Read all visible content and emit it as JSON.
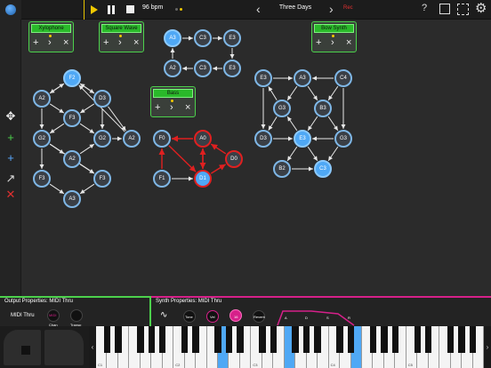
{
  "topbar": {
    "bpm": "96 bpm",
    "song_title": "Three Days",
    "record_label": "Rec",
    "help_label": "?",
    "prev_symbol": "‹",
    "next_symbol": "›",
    "gear_symbol": "⚙"
  },
  "instruments": [
    {
      "id": "xylophone",
      "name": "Xylophone"
    },
    {
      "id": "square_wave",
      "name": "Square Wave"
    },
    {
      "id": "bass",
      "name": "Bass"
    },
    {
      "id": "bow_synth",
      "name": "Bow Synth"
    }
  ],
  "instrument_controls": [
    "+",
    "›",
    "×"
  ],
  "nodes": [
    {
      "label": "F2",
      "style": "light"
    },
    {
      "label": "A2",
      "style": "dark"
    },
    {
      "label": "D3",
      "style": "dark"
    },
    {
      "label": "F3",
      "style": "dark"
    },
    {
      "label": "G2",
      "style": "dark"
    },
    {
      "label": "G2",
      "style": "dark"
    },
    {
      "label": "A2",
      "style": "dark"
    },
    {
      "label": "A2",
      "style": "dark"
    },
    {
      "label": "F3",
      "style": "dark"
    },
    {
      "label": "F3",
      "style": "dark"
    },
    {
      "label": "A3",
      "style": "dark"
    },
    {
      "label": "A3",
      "style": "light"
    },
    {
      "label": "C3",
      "style": "dark"
    },
    {
      "label": "E3",
      "style": "dark"
    },
    {
      "label": "E3",
      "style": "dark"
    },
    {
      "label": "C3",
      "style": "dark"
    },
    {
      "label": "A2",
      "style": "dark"
    },
    {
      "label": "F0",
      "style": "dark"
    },
    {
      "label": "A0",
      "style": "red"
    },
    {
      "label": "D0",
      "style": "red"
    },
    {
      "label": "F1",
      "style": "dark"
    },
    {
      "label": "D1",
      "style": "lightred"
    },
    {
      "label": "E3",
      "style": "dark"
    },
    {
      "label": "A3",
      "style": "dark"
    },
    {
      "label": "C4",
      "style": "dark"
    },
    {
      "label": "G3",
      "style": "dark"
    },
    {
      "label": "B3",
      "style": "dark"
    },
    {
      "label": "D3",
      "style": "dark"
    },
    {
      "label": "E3",
      "style": "light"
    },
    {
      "label": "G3",
      "style": "dark"
    },
    {
      "label": "B2",
      "style": "dark"
    },
    {
      "label": "C3",
      "style": "light"
    }
  ],
  "bottom": {
    "output_title": "Output Properties: MIDI Thru",
    "output_device": "MIDI Thru",
    "output_knobs": [
      {
        "label": "Chan",
        "value": "MIDI"
      },
      {
        "label": "Transp",
        "value": ""
      }
    ],
    "synth_title": "Synth Properties: MIDI Thru",
    "synth_knobs": [
      {
        "label": "Tone",
        "value": ""
      },
      {
        "label": "Vel",
        "value": ""
      },
      {
        "label": "Rel",
        "value": "16"
      },
      {
        "label": "Reverb",
        "value": ""
      }
    ],
    "envelope_labels": [
      "A",
      "D",
      "S",
      "R"
    ],
    "octave_labels": [
      "C1",
      "C2",
      "C3",
      "C4",
      "C5"
    ],
    "kb_left_symbol": "‹",
    "kb_right_symbol": "›"
  },
  "colors": {
    "accent_yellow": "#f0c800",
    "note_blue": "#4fa8f5",
    "instrument_green": "#4cd14c",
    "bass_red": "#e02020",
    "synth_pink": "#d6208a"
  }
}
